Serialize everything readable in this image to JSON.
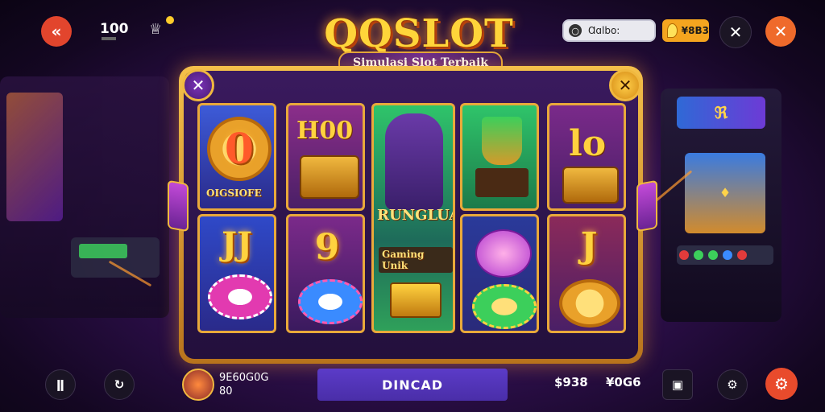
{
  "header": {
    "back_icon": "back-chevron-icon",
    "balance_count": "100",
    "chef_icon": "chef-hat-icon",
    "search": {
      "text": "Ɑɑlbo:",
      "icon": "search-icon"
    },
    "coins": {
      "text": "¥8B3",
      "icon": "gem-icon"
    },
    "close_icon": "close-icon",
    "exit_icon": "close-icon"
  },
  "logo": {
    "title": "QQSLOT",
    "subtitle": "Simulasi Slot Terbaik"
  },
  "reels": {
    "r1_top_label": "OIGSIOFE",
    "r2_top_text": "H00",
    "r3_main_text": "RUNGLUA",
    "r3_banner": "Gaming Unik",
    "r4_trophy_icon": "trophy-icon",
    "r5_top_text": "lo",
    "r1_mid_text": "JJ",
    "r2_mid_text": "9",
    "r5_mid_text": "J"
  },
  "footer": {
    "player_name": "9E60G0G",
    "player_sub": "80",
    "spin_label": "DINCAD",
    "value_1": "$938",
    "value_2": "¥0G6",
    "stats_icon": "stats-icon",
    "refresh_icon": "refresh-icon",
    "map_icon": "map-icon",
    "settings_icon": "gear-icon",
    "power_icon": "power-icon"
  },
  "colors": {
    "accent_gold": "#f0b83f",
    "accent_orange": "#ef6a2b",
    "bg_purple": "#2e0f4d",
    "button_purple": "#5b3bc8"
  }
}
